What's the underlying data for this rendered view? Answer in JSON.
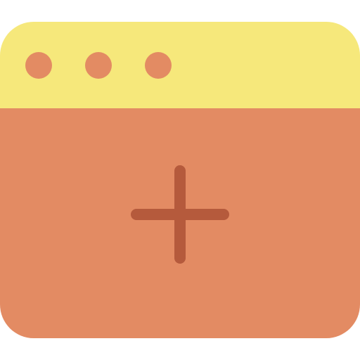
{
  "icon": {
    "name": "new-window-icon",
    "colors": {
      "title_bar": "#F6E87B",
      "body": "#E38B63",
      "dots": "#E38B63",
      "plus": "#B55A3C"
    },
    "title_bar": {
      "dots": [
        "window-dot",
        "window-dot",
        "window-dot"
      ]
    },
    "content": {
      "glyph": "plus-icon"
    }
  }
}
